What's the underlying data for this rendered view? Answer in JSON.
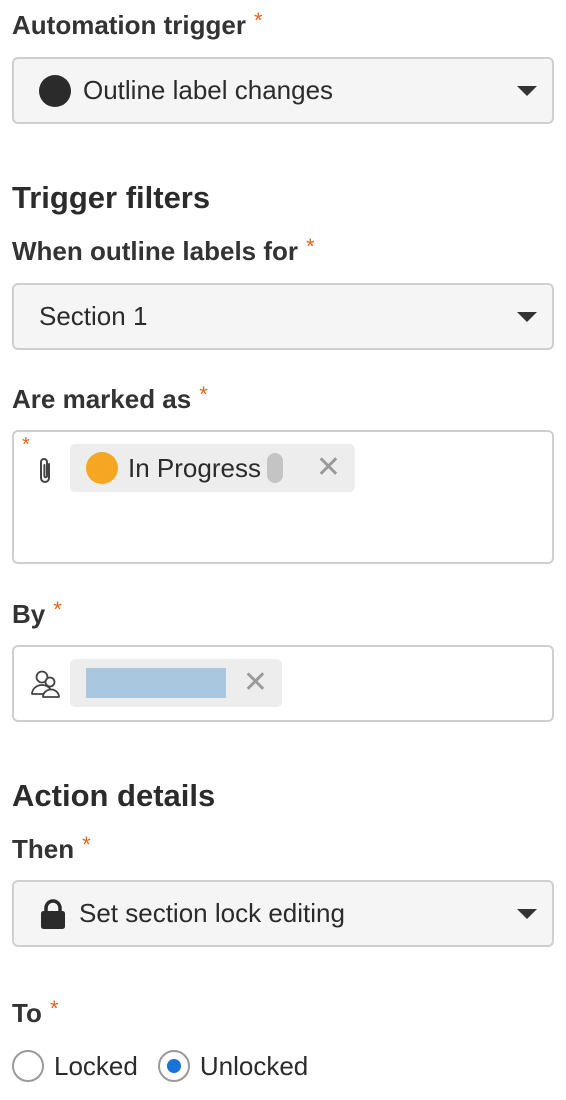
{
  "trigger": {
    "label": "Automation trigger",
    "required": "*",
    "value": "Outline label changes",
    "icon": "circle-icon"
  },
  "filters": {
    "heading": "Trigger filters",
    "when_label": "When outline labels for",
    "when_required": "*",
    "when_value": "Section 1",
    "marked_label": "Are marked as",
    "marked_required": "*",
    "marked_inner_required": "*",
    "marked_icon": "paperclip-icon",
    "marked_chip": {
      "text": "In Progress",
      "color": "#f5a623",
      "remove": "✕"
    },
    "by_label": "By",
    "by_required": "*",
    "by_icon": "users-icon",
    "by_chip": {
      "remove": "✕"
    }
  },
  "action": {
    "heading": "Action details",
    "then_label": "Then",
    "then_required": "*",
    "then_value": "Set section lock editing",
    "then_icon": "lock-icon",
    "to_label": "To",
    "to_required": "*",
    "options": [
      {
        "label": "Locked",
        "checked": false
      },
      {
        "label": "Unlocked",
        "checked": true
      }
    ],
    "accent": "#1a73d9"
  }
}
